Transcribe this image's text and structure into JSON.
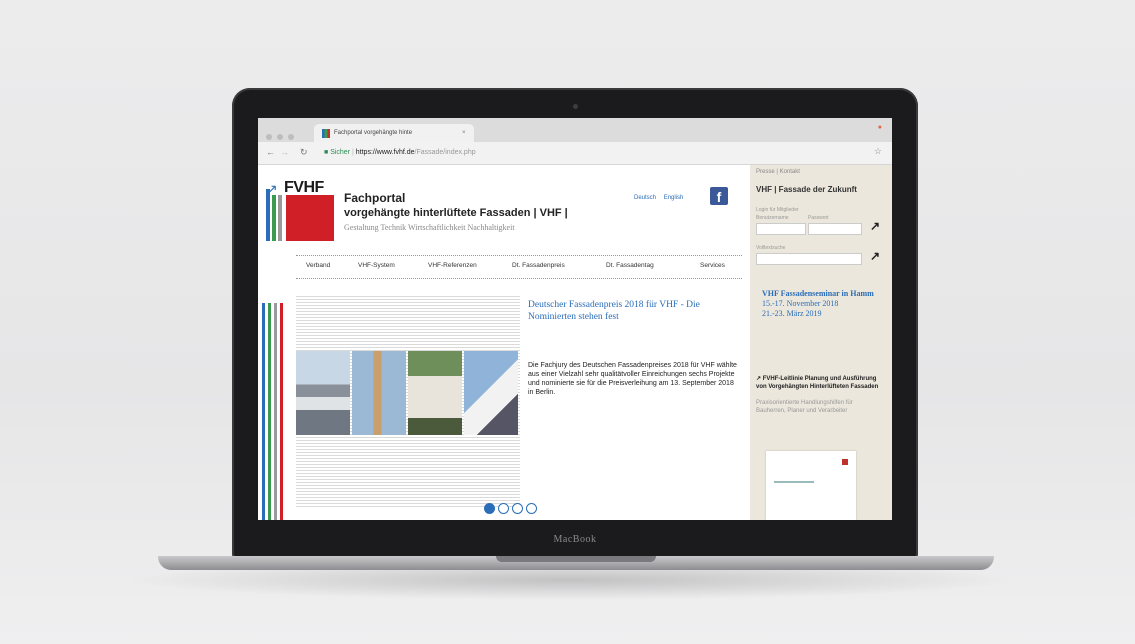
{
  "browser": {
    "tab_title": "Fachportal vorgehängte hinte",
    "tab_close": "×",
    "url_security": "Sicher",
    "url_host": "https://www.fvhf.de",
    "url_path": "/Fassade/index.php"
  },
  "site": {
    "logo_text": "FVHF",
    "title_line1": "Fachportal",
    "title_line2": "vorgehängte hinterlüftete Fassaden | VHF |",
    "tagline": "Gestaltung Technik Wirtschaftlichkeit Nachhaltigkeit",
    "lang_de": "Deutsch",
    "lang_en": "English",
    "facebook_glyph": "f",
    "nav": [
      "Verband",
      "VHF-System",
      "VHF-Referenzen",
      "Dt. Fassadenpreis",
      "Dt. Fassadentag",
      "Services"
    ]
  },
  "slide": {
    "headline": "Deutscher Fassadenpreis 2018 für VHF - Die Nominierten stehen fest",
    "body": "Die Fachjury des Deutschen Fassadenpreises 2018 für VHF wählte aus einer Vielzahl sehr qualitätvoller Einreichungen sechs Projekte und nominierte sie für die Preisverleihung am 13. September 2018 in Berlin.",
    "pager_active": 1,
    "pager_count": 4
  },
  "sidebar": {
    "links": "Presse | Kontakt",
    "heading": "VHF | Fassade der Zukunft",
    "login_label": "Login für Mitglieder",
    "user_label": "Benutzername",
    "pass_label": "Passwort",
    "search_label": "Volltextsuche",
    "event_title": "VHF Fassadenseminar in Hamm",
    "event_date1": "15.-17. November 2018",
    "event_date2": "21.-23. März 2019",
    "guide_title": "↗ FVHF-Leitlinie Planung und Ausführung von Vorgehängten Hinterlüfteten Fassaden",
    "guide_desc": "Praxisorientierte Handlungshilfen für Bauherren, Planer und Verarbeiter"
  },
  "device": {
    "brand": "MacBook"
  },
  "colors": {
    "blue": "#2a6db8",
    "green": "#3a9a4e",
    "red": "#d01f26",
    "sidebar_bg": "#ece7dc"
  }
}
